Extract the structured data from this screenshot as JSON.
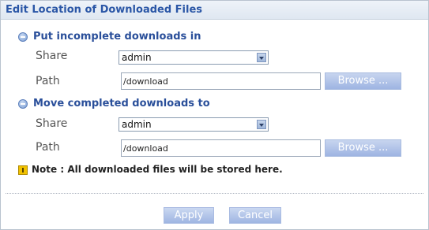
{
  "dialog": {
    "title": "Edit Location of Downloaded Files"
  },
  "incomplete": {
    "heading": "Put incomplete downloads in",
    "share_label": "Share",
    "share_value": "admin",
    "path_label": "Path",
    "path_value": "/download",
    "browse_label": "Browse ..."
  },
  "completed": {
    "heading": "Move completed downloads to",
    "share_label": "Share",
    "share_value": "admin",
    "path_label": "Path",
    "path_value": "/download",
    "browse_label": "Browse ..."
  },
  "note": "Note : All downloaded files will be stored here.",
  "footer": {
    "apply_label": "Apply",
    "cancel_label": "Cancel"
  },
  "icons": {
    "section": "collapse-icon",
    "dropdown": "chevron-down-icon",
    "note": "info-icon"
  },
  "colors": {
    "title_text": "#2a56a6",
    "section_text": "#2a4f9a",
    "button_fill": "#9fb5e2"
  }
}
